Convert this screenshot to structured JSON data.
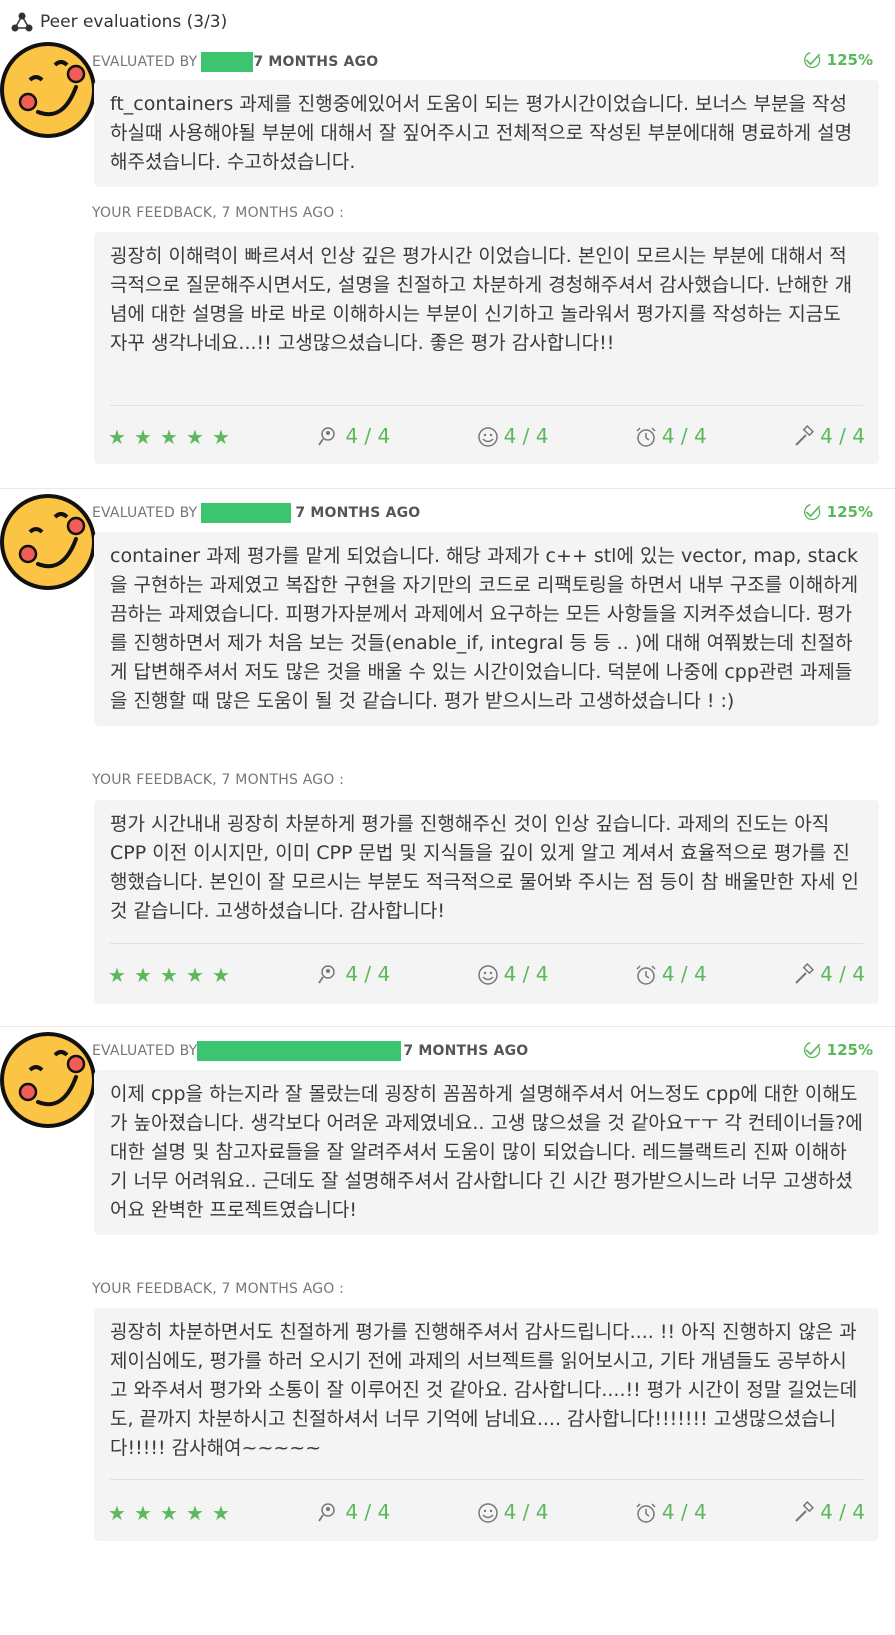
{
  "header": {
    "title": "Peer evaluations (3/3)"
  },
  "colors": {
    "accent": "#5cb85c",
    "redaction": "#3cc46f",
    "bubble": "#f4f4f4"
  },
  "evaluations": [
    {
      "evaluated_by": "EVALUATED BY",
      "time": "7 MONTHS AGO",
      "mark": "125%",
      "comment": "ft_containers 과제를 진행중에있어서 도움이 되는 평가시간이었습니다. 보너스 부분을 작성하실때 사용해야될 부분에 대해서 잘 짚어주시고 전체적으로 작성된 부분에대해 명료하게 설명해주셨습니다. 수고하셨습니다.",
      "feedback_title": "YOUR FEEDBACK, 7 MONTHS AGO :",
      "feedback": "굉장히 이해력이 빠르셔서 인상 깊은 평가시간 이었습니다. 본인이 모르시는 부분에 대해서 적극적으로 질문해주시면서도, 설명을 친절하고 차분하게 경청해주셔서 감사했습니다. 난해한 개념에 대한 설명을 바로 바로 이해하시는 부분이 신기하고 놀라워서 평가지를 작성하는 지금도 자꾸 생각나네요...!! 고생많으셨습니다. 좋은 평가 감사합니다!!",
      "ratings": [
        "4 / 4",
        "4 / 4",
        "4 / 4",
        "4 / 4"
      ]
    },
    {
      "evaluated_by": "EVALUATED BY",
      "time": "7 MONTHS AGO",
      "mark": "125%",
      "comment": "container 과제 평가를 맡게 되었습니다. 해당 과제가 c++ stl에 있는 vector, map, stack을 구현하는 과제였고 복잡한 구현을 자기만의 코드로 리팩토링을 하면서 내부 구조를 이해하게끔하는 과제였습니다. 피평가자분께서 과제에서 요구하는 모든 사항들을 지켜주셨습니다. 평가를 진행하면서 제가 처음 보는 것들(enable_if, integral 등 등 .. )에 대해 여쭤봤는데 친절하게 답변해주셔서 저도 많은 것을 배울 수 있는 시간이었습니다. 덕분에 나중에 cpp관련 과제들을 진행할 때 많은 도움이 될 것 같습니다. 평가 받으시느라 고생하셨습니다 ! :)",
      "feedback_title": "YOUR FEEDBACK, 7 MONTHS AGO :",
      "feedback": "평가 시간내내 굉장히 차분하게 평가를 진행해주신 것이 인상 깊습니다. 과제의 진도는 아직 CPP 이전 이시지만, 이미 CPP 문법 및 지식들을 깊이 있게 알고 계셔서 효율적으로 평가를 진행했습니다. 본인이 잘 모르시는 부분도 적극적으로 물어봐 주시는 점 등이 참 배울만한 자세 인 것 같습니다. 고생하셨습니다. 감사합니다!",
      "ratings": [
        "4 / 4",
        "4 / 4",
        "4 / 4",
        "4 / 4"
      ]
    },
    {
      "evaluated_by": "EVALUATED BY",
      "time": "7 MONTHS AGO",
      "mark": "125%",
      "comment": "이제 cpp을 하는지라 잘 몰랐는데 굉장히 꼼꼼하게 설명해주셔서 어느정도 cpp에 대한 이해도가 높아졌습니다. 생각보다 어려운 과제였네요.. 고생 많으셨을 것 같아요ㅜㅜ 각 컨테이너들?에 대한 설명 및 참고자료들을 잘 알려주셔서 도움이 많이 되었습니다. 레드블랙트리 진짜 이해하기 너무 어려워요.. 근데도 잘 설명해주셔서 감사합니다 긴 시간 평가받으시느라 너무 고생하셨어요 완벽한 프로젝트였습니다!",
      "feedback_title": "YOUR FEEDBACK, 7 MONTHS AGO :",
      "feedback": "굉장히 차분하면서도 친절하게 평가를 진행해주셔서 감사드립니다.... !! 아직 진행하지 않은 과제이심에도, 평가를 하러 오시기 전에 과제의 서브젝트를 읽어보시고, 기타 개념들도 공부하시고 와주셔서 평가와 소통이 잘 이루어진 것 같아요. 감사합니다....!! 평가 시간이 정말 길었는데도, 끝까지 차분하시고 친절하셔서 너무 기억에 남네요.... 감사합니다!!!!!!! 고생많으셨습니다!!!!! 감사해여~~~~~",
      "ratings": [
        "4 / 4",
        "4 / 4",
        "4 / 4",
        "4 / 4"
      ]
    }
  ]
}
